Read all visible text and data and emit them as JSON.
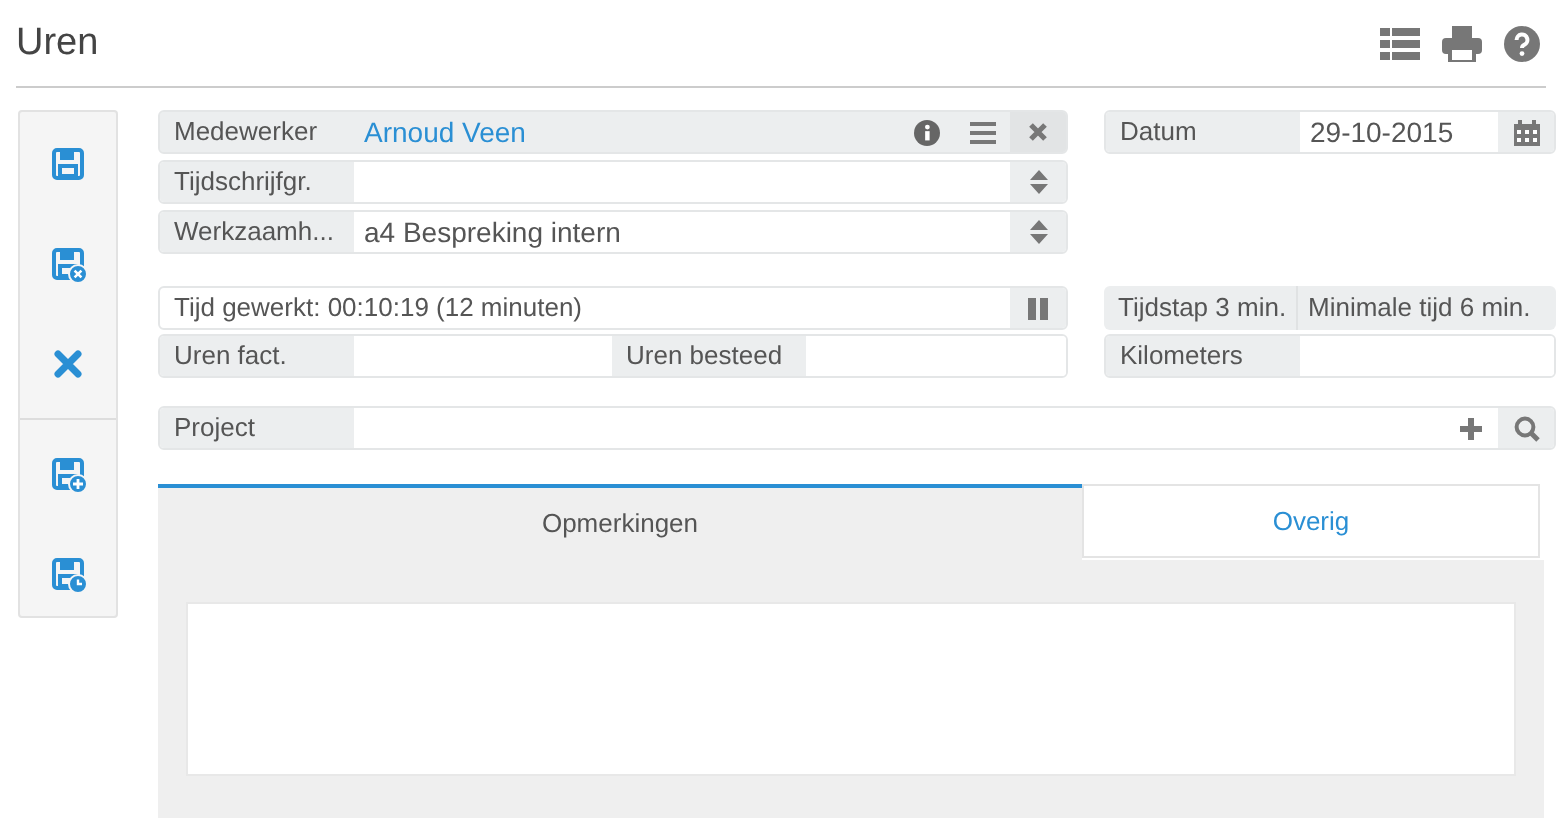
{
  "header": {
    "title": "Uren"
  },
  "form": {
    "employee": {
      "label": "Medewerker",
      "value": "Arnoud Veen"
    },
    "time_group": {
      "label": "Tijdschrijfgr."
    },
    "activity": {
      "label": "Werkzaamh...",
      "value": "a4 Bespreking intern"
    },
    "date": {
      "label": "Datum",
      "value": "29-10-2015"
    },
    "time_worked": "Tijd gewerkt: 00:10:19 (12 minuten)",
    "billed_hours": {
      "label": "Uren fact."
    },
    "spent_hours": {
      "label": "Uren besteed"
    },
    "time_step": "Tijdstap 3 min.",
    "minimum_time": "Minimale tijd 6 min.",
    "kilometers": {
      "label": "Kilometers"
    },
    "project": {
      "label": "Project"
    }
  },
  "tabs": [
    {
      "label": "Opmerkingen",
      "selected": true
    },
    {
      "label": "Overig",
      "selected": false
    }
  ]
}
